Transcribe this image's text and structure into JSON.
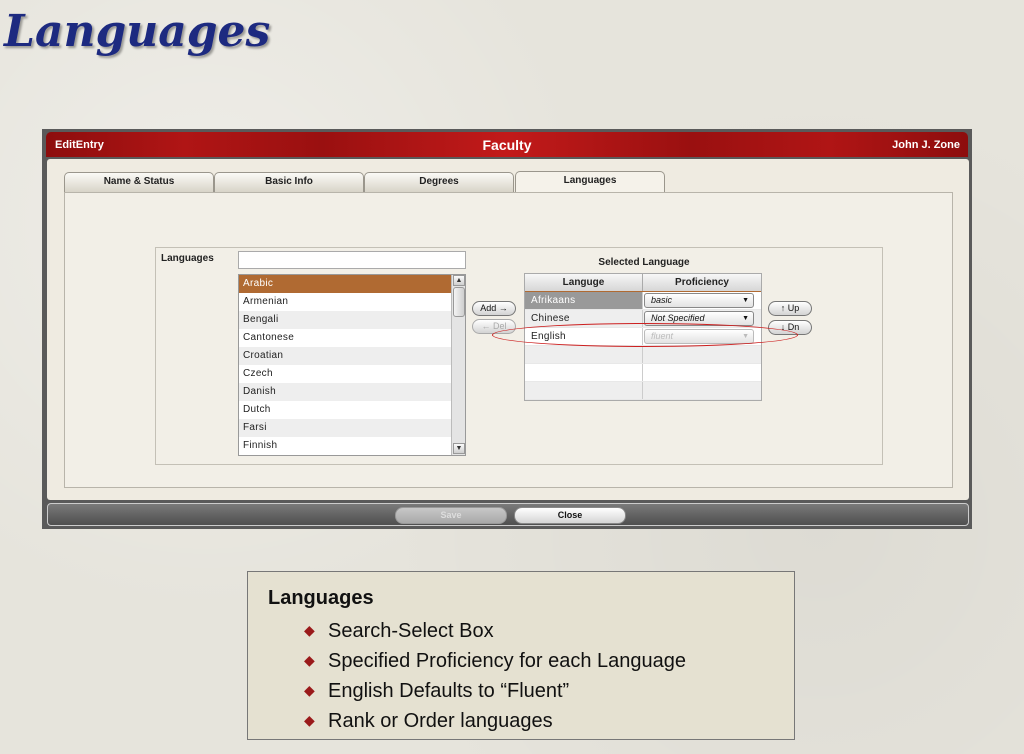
{
  "slide": {
    "title": "Languages"
  },
  "window": {
    "title_left": "EditEntry",
    "title_center": "Faculty",
    "title_right": "John J. Zone"
  },
  "tabs": [
    {
      "label": "Name & Status",
      "active": false
    },
    {
      "label": "Basic Info",
      "active": false
    },
    {
      "label": "Degrees",
      "active": false
    },
    {
      "label": "Languages",
      "active": true
    }
  ],
  "languages": {
    "label": "Languages",
    "search_value": "",
    "list": [
      {
        "name": "Arabic",
        "selected": true
      },
      {
        "name": "Armenian"
      },
      {
        "name": "Bengali"
      },
      {
        "name": "Cantonese"
      },
      {
        "name": "Croatian"
      },
      {
        "name": "Czech"
      },
      {
        "name": "Danish"
      },
      {
        "name": "Dutch"
      },
      {
        "name": "Farsi"
      },
      {
        "name": "Finnish"
      }
    ],
    "add_label": "Add →",
    "del_label": "← Del"
  },
  "selected": {
    "title": "Selected Language",
    "col_language": "Languge",
    "col_proficiency": "Proficiency",
    "rows": [
      {
        "language": "Afrikaans",
        "proficiency": "basic",
        "enabled": true
      },
      {
        "language": "Chinese",
        "proficiency": "Not Specified",
        "enabled": true
      },
      {
        "language": "English",
        "proficiency": "fluent",
        "enabled": false
      }
    ],
    "up_label": "↑ Up",
    "down_label": "↓ Dn"
  },
  "footer": {
    "save_label": "Save",
    "close_label": "Close"
  },
  "note": {
    "title": "Languages",
    "bullets": [
      "Search-Select Box",
      "Specified Proficiency for each Language",
      "English Defaults to “Fluent”",
      "Rank or Order languages"
    ]
  },
  "colors": {
    "title_bar": "#9a1010",
    "selection": "#b06a32",
    "slide_title": "#1d2a80"
  }
}
